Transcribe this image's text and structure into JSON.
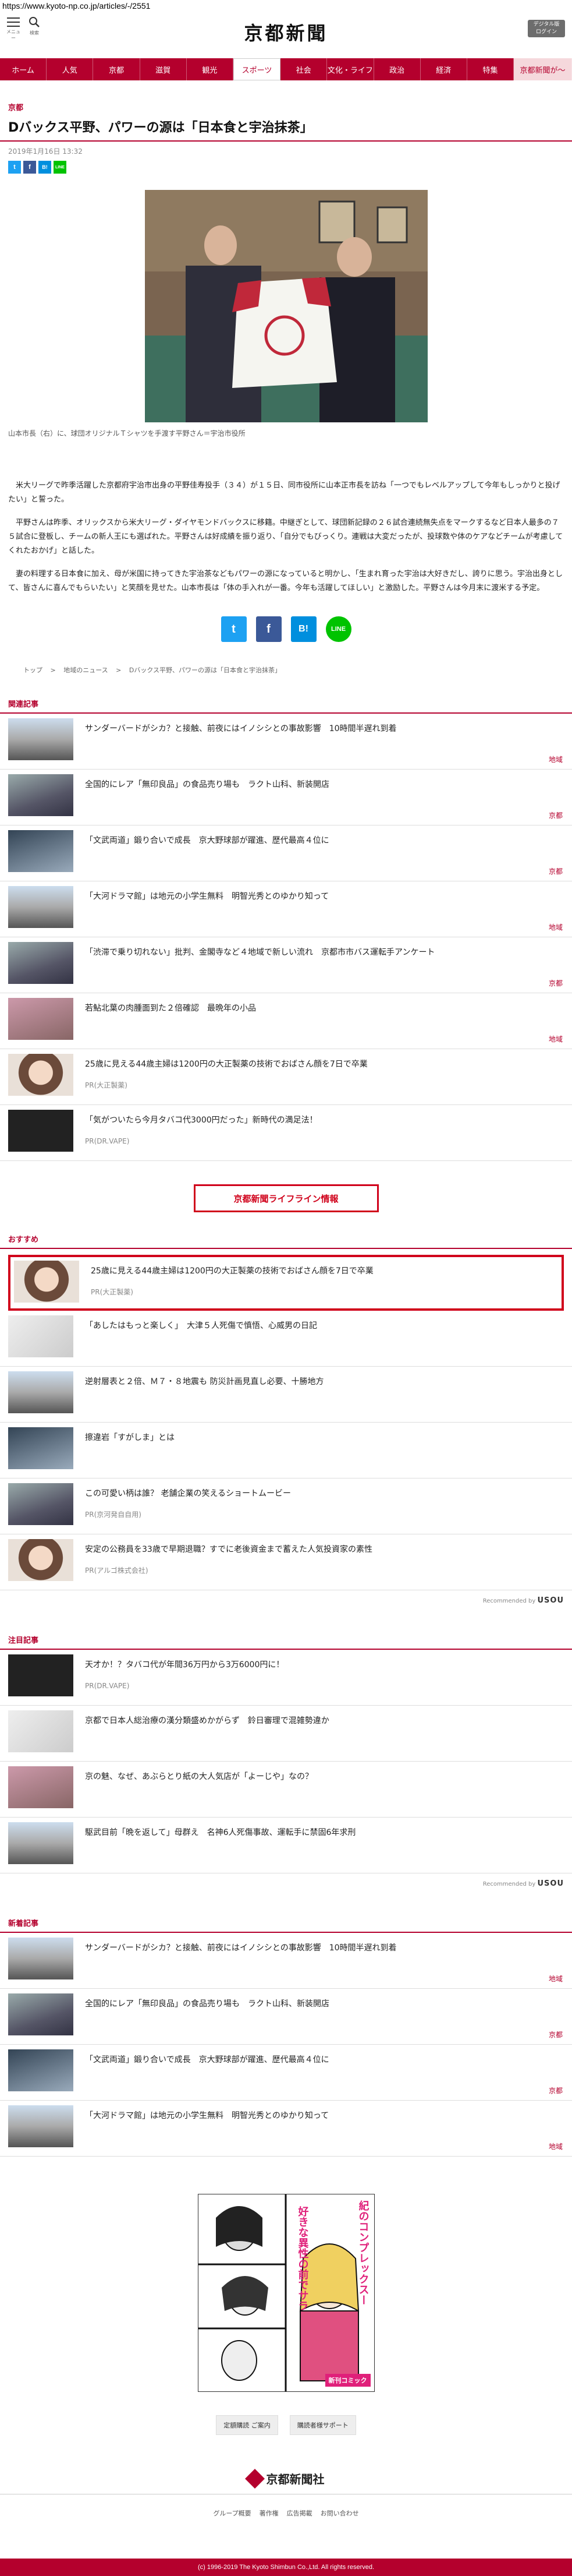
{
  "url": "https://www.kyoto-np.co.jp/articles/-/2551",
  "header": {
    "menu_label": "メニュー",
    "search_label": "検索",
    "logo": "京都新聞",
    "digital_btn": "デジタル版\nログイン"
  },
  "nav": [
    "ホーム",
    "人気",
    "京都",
    "滋賀",
    "観光",
    "スポーツ",
    "社会",
    "文化・ライフ",
    "政治",
    "経済",
    "特集",
    "京都新聞が～"
  ],
  "article": {
    "section": "京都",
    "title": "Dバックス平野、パワーの源は「日本食と宇治抹茶」",
    "date": "2019年1月16日 13:32",
    "photo_caption": "山本市長（右）に、球団オリジナルＴシャツを手渡す平野さん＝宇治市役所",
    "paragraphs": [
      "米大リーグで昨季活躍した京都府宇治市出身の平野佳寿投手（３４）が１５日、同市役所に山本正市長を訪ね「一つでもレベルアップして今年もしっかりと投げたい」と誓った。",
      "平野さんは昨季、オリックスから米大リーグ・ダイヤモンドバックスに移籍。中継ぎとして、球団新記録の２６試合連続無失点をマークするなど日本人最多の７５試合に登板し、チームの新人王にも選ばれた。平野さんは好成績を振り返り、「自分でもびっくり。連戦は大変だったが、投球数や体のケアなどチームが考慮してくれたおかげ」と話した。",
      "妻の料理する日本食に加え、母が米国に持ってきた宇治茶などもパワーの源になっていると明かし、「生まれ育った宇治は大好きだし、誇りに思う。宇治出身として、皆さんに喜んでもらいたい」と笑顔を見せた。山本市長は「体の手入れが一番。今年も活躍してほしい」と激励した。平野さんは今月末に渡米する予定。"
    ],
    "share": [
      "t",
      "f",
      "B!",
      "LINE"
    ],
    "breadcrumb": [
      "トップ",
      ">",
      "地域のニュース",
      ">",
      "Dバックス平野、パワーの源は「日本食と宇治抹茶」"
    ]
  },
  "related": {
    "heading": "関連記事",
    "items": [
      {
        "title": "サンダーバードがシカ？と接触、前夜にはイノシシとの事故影響　10時間半遅れ到着",
        "tag": "地域"
      },
      {
        "title": "全国的にレア「無印良品」の食品売り場も　ラクト山科、新装開店",
        "tag": "京都"
      },
      {
        "title": "「文武両道」鍛り合いで成長　京大野球部が躍進、歴代最高４位に",
        "tag": "京都"
      },
      {
        "title": "「大河ドラマ館」は地元の小学生無料　明智光秀とのゆかり知って",
        "tag": "地域"
      },
      {
        "title": "「渋滞で乗り切れない」批判、金閣寺など４地域で新しい流れ　京都市市バス運転手アンケート",
        "tag": "京都"
      },
      {
        "title": "若鮎北葉の肉腫面到た２倍確認　最晩年の小品",
        "tag": "地域"
      },
      {
        "title": "25歳に見える44歳主婦は1200円の大正製薬の技術でおばさん顔を7日で卒業",
        "pr": "PR(大正製薬)"
      },
      {
        "title": "「気がついたら今月タバコ代3000円だった」新時代の満足法！",
        "pr": "PR(DR.VAPE)"
      }
    ]
  },
  "lifeline": "京都新聞ライフライン情報",
  "recommend": {
    "heading": "おすすめ",
    "items": [
      {
        "title": "25歳に見える44歳主婦は1200円の大正製薬の技術でおばさん顔を7日で卒業",
        "pr": "PR(大正製薬)"
      },
      {
        "title": "「あしたはもっと楽しく」　大津５人死傷で慎悟、心威男の日記",
        "pr": ""
      },
      {
        "title": "逆射層表と２倍、Ｍ７・８地震も 防災計画見直し必要、十勝地方",
        "pr": ""
      },
      {
        "title": "擦違岩「すがしま」とは",
        "pr": ""
      },
      {
        "title": "この可愛い柄は誰？ 老舗企業の笑えるショートムービー",
        "pr": "PR(京河発自自用)"
      },
      {
        "title": "安定の公務員を33歳で早期退職？すでに老後資金まで蓄えた人気投資家の素性",
        "pr": "PR(アルゴ株式会社)"
      }
    ],
    "credit_label": "Recommended by",
    "credit_brand": "USOU"
  },
  "featured": {
    "heading": "注目記事",
    "items": [
      {
        "title": "天才か！？タバコ代が年間36万円から3万6000円に！",
        "pr": "PR(DR.VAPE)"
      },
      {
        "title": "京都で日本人総治療の漢分類盛めかがらず　鈴日審理で混雑勢違か",
        "pr": ""
      },
      {
        "title": "京の魅、なぜ、あぶらとり紙の大人気店が「よーじや」なの？",
        "pr": ""
      },
      {
        "title": "駆武目前「晩を返して」母群え　名神6人死傷事故、運転手に禁固6年求刑",
        "pr": ""
      }
    ],
    "credit_label": "Recommended by",
    "credit_brand": "USOU"
  },
  "latest": {
    "heading": "新着記事",
    "items": [
      {
        "title": "サンダーバードがシカ？と接触、前夜にはイノシシとの事故影響　10時間半遅れ到着",
        "tag": "地域"
      },
      {
        "title": "全国的にレア「無印良品」の食品売り場も　ラクト山科、新装開店",
        "tag": "京都"
      },
      {
        "title": "「文武両道」鍛り合いで成長　京大野球部が躍進、歴代最高４位に",
        "tag": "京都"
      },
      {
        "title": "「大河ドラマ館」は地元の小学生無料　明智光秀とのゆかり知って",
        "tag": "地域"
      }
    ]
  },
  "ad": {
    "text1": "好きな異性の前でサラ",
    "text2": "紀のコンプレックスー",
    "text3": "新刊コミック"
  },
  "footer": {
    "links": [
      "定額購読 ご案内",
      "購読者様サポート"
    ],
    "logo": "京都新聞社",
    "nav": [
      "グループ概要",
      "著作権",
      "広告掲載",
      "お問い合わせ"
    ],
    "copyright": "(c) 1996-2019 The Kyoto Shimbun Co.,Ltd. All rights reserved."
  },
  "colors": {
    "brand": "#b4002d",
    "highlight": "#d0021b",
    "twitter": "#1da1f2",
    "facebook": "#3b5998",
    "hatena": "#008fde",
    "line": "#00c300"
  }
}
